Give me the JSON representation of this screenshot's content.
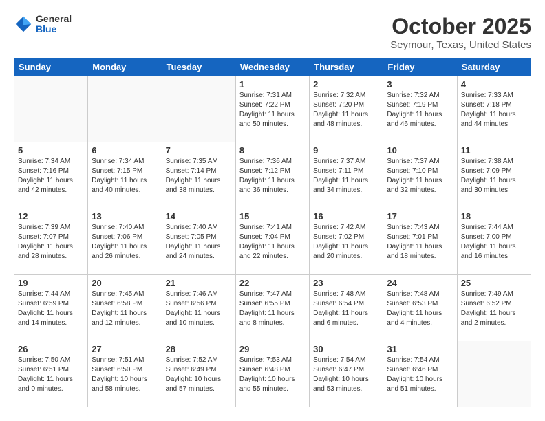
{
  "logo": {
    "general": "General",
    "blue": "Blue"
  },
  "header": {
    "month": "October 2025",
    "location": "Seymour, Texas, United States"
  },
  "days": [
    "Sunday",
    "Monday",
    "Tuesday",
    "Wednesday",
    "Thursday",
    "Friday",
    "Saturday"
  ],
  "weeks": [
    [
      {
        "num": "",
        "lines": []
      },
      {
        "num": "",
        "lines": []
      },
      {
        "num": "",
        "lines": []
      },
      {
        "num": "1",
        "lines": [
          "Sunrise: 7:31 AM",
          "Sunset: 7:22 PM",
          "Daylight: 11 hours",
          "and 50 minutes."
        ]
      },
      {
        "num": "2",
        "lines": [
          "Sunrise: 7:32 AM",
          "Sunset: 7:20 PM",
          "Daylight: 11 hours",
          "and 48 minutes."
        ]
      },
      {
        "num": "3",
        "lines": [
          "Sunrise: 7:32 AM",
          "Sunset: 7:19 PM",
          "Daylight: 11 hours",
          "and 46 minutes."
        ]
      },
      {
        "num": "4",
        "lines": [
          "Sunrise: 7:33 AM",
          "Sunset: 7:18 PM",
          "Daylight: 11 hours",
          "and 44 minutes."
        ]
      }
    ],
    [
      {
        "num": "5",
        "lines": [
          "Sunrise: 7:34 AM",
          "Sunset: 7:16 PM",
          "Daylight: 11 hours",
          "and 42 minutes."
        ]
      },
      {
        "num": "6",
        "lines": [
          "Sunrise: 7:34 AM",
          "Sunset: 7:15 PM",
          "Daylight: 11 hours",
          "and 40 minutes."
        ]
      },
      {
        "num": "7",
        "lines": [
          "Sunrise: 7:35 AM",
          "Sunset: 7:14 PM",
          "Daylight: 11 hours",
          "and 38 minutes."
        ]
      },
      {
        "num": "8",
        "lines": [
          "Sunrise: 7:36 AM",
          "Sunset: 7:12 PM",
          "Daylight: 11 hours",
          "and 36 minutes."
        ]
      },
      {
        "num": "9",
        "lines": [
          "Sunrise: 7:37 AM",
          "Sunset: 7:11 PM",
          "Daylight: 11 hours",
          "and 34 minutes."
        ]
      },
      {
        "num": "10",
        "lines": [
          "Sunrise: 7:37 AM",
          "Sunset: 7:10 PM",
          "Daylight: 11 hours",
          "and 32 minutes."
        ]
      },
      {
        "num": "11",
        "lines": [
          "Sunrise: 7:38 AM",
          "Sunset: 7:09 PM",
          "Daylight: 11 hours",
          "and 30 minutes."
        ]
      }
    ],
    [
      {
        "num": "12",
        "lines": [
          "Sunrise: 7:39 AM",
          "Sunset: 7:07 PM",
          "Daylight: 11 hours",
          "and 28 minutes."
        ]
      },
      {
        "num": "13",
        "lines": [
          "Sunrise: 7:40 AM",
          "Sunset: 7:06 PM",
          "Daylight: 11 hours",
          "and 26 minutes."
        ]
      },
      {
        "num": "14",
        "lines": [
          "Sunrise: 7:40 AM",
          "Sunset: 7:05 PM",
          "Daylight: 11 hours",
          "and 24 minutes."
        ]
      },
      {
        "num": "15",
        "lines": [
          "Sunrise: 7:41 AM",
          "Sunset: 7:04 PM",
          "Daylight: 11 hours",
          "and 22 minutes."
        ]
      },
      {
        "num": "16",
        "lines": [
          "Sunrise: 7:42 AM",
          "Sunset: 7:02 PM",
          "Daylight: 11 hours",
          "and 20 minutes."
        ]
      },
      {
        "num": "17",
        "lines": [
          "Sunrise: 7:43 AM",
          "Sunset: 7:01 PM",
          "Daylight: 11 hours",
          "and 18 minutes."
        ]
      },
      {
        "num": "18",
        "lines": [
          "Sunrise: 7:44 AM",
          "Sunset: 7:00 PM",
          "Daylight: 11 hours",
          "and 16 minutes."
        ]
      }
    ],
    [
      {
        "num": "19",
        "lines": [
          "Sunrise: 7:44 AM",
          "Sunset: 6:59 PM",
          "Daylight: 11 hours",
          "and 14 minutes."
        ]
      },
      {
        "num": "20",
        "lines": [
          "Sunrise: 7:45 AM",
          "Sunset: 6:58 PM",
          "Daylight: 11 hours",
          "and 12 minutes."
        ]
      },
      {
        "num": "21",
        "lines": [
          "Sunrise: 7:46 AM",
          "Sunset: 6:56 PM",
          "Daylight: 11 hours",
          "and 10 minutes."
        ]
      },
      {
        "num": "22",
        "lines": [
          "Sunrise: 7:47 AM",
          "Sunset: 6:55 PM",
          "Daylight: 11 hours",
          "and 8 minutes."
        ]
      },
      {
        "num": "23",
        "lines": [
          "Sunrise: 7:48 AM",
          "Sunset: 6:54 PM",
          "Daylight: 11 hours",
          "and 6 minutes."
        ]
      },
      {
        "num": "24",
        "lines": [
          "Sunrise: 7:48 AM",
          "Sunset: 6:53 PM",
          "Daylight: 11 hours",
          "and 4 minutes."
        ]
      },
      {
        "num": "25",
        "lines": [
          "Sunrise: 7:49 AM",
          "Sunset: 6:52 PM",
          "Daylight: 11 hours",
          "and 2 minutes."
        ]
      }
    ],
    [
      {
        "num": "26",
        "lines": [
          "Sunrise: 7:50 AM",
          "Sunset: 6:51 PM",
          "Daylight: 11 hours",
          "and 0 minutes."
        ]
      },
      {
        "num": "27",
        "lines": [
          "Sunrise: 7:51 AM",
          "Sunset: 6:50 PM",
          "Daylight: 10 hours",
          "and 58 minutes."
        ]
      },
      {
        "num": "28",
        "lines": [
          "Sunrise: 7:52 AM",
          "Sunset: 6:49 PM",
          "Daylight: 10 hours",
          "and 57 minutes."
        ]
      },
      {
        "num": "29",
        "lines": [
          "Sunrise: 7:53 AM",
          "Sunset: 6:48 PM",
          "Daylight: 10 hours",
          "and 55 minutes."
        ]
      },
      {
        "num": "30",
        "lines": [
          "Sunrise: 7:54 AM",
          "Sunset: 6:47 PM",
          "Daylight: 10 hours",
          "and 53 minutes."
        ]
      },
      {
        "num": "31",
        "lines": [
          "Sunrise: 7:54 AM",
          "Sunset: 6:46 PM",
          "Daylight: 10 hours",
          "and 51 minutes."
        ]
      },
      {
        "num": "",
        "lines": []
      }
    ]
  ]
}
